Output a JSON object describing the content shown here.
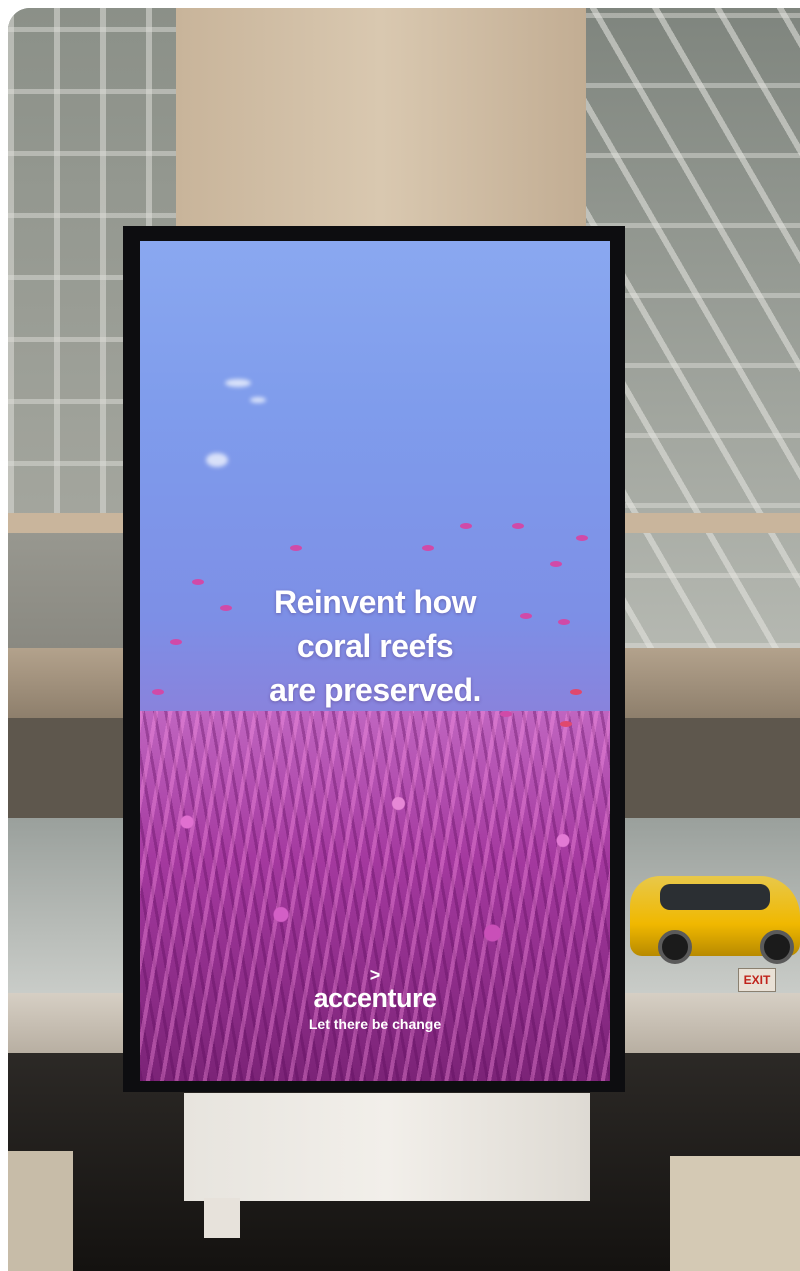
{
  "screen": {
    "headline_lines": [
      "Reinvent how",
      "coral reefs",
      "are preserved."
    ],
    "brand": {
      "logo_mark": ">",
      "name": "accenture",
      "tagline": "Let there be change"
    }
  },
  "background": {
    "exit_sign": "EXIT"
  },
  "colors": {
    "headline_text": "#ffffff",
    "water_top": "#8aa8f0",
    "coral": "#b04aa8",
    "taxi": "#f0b800"
  }
}
